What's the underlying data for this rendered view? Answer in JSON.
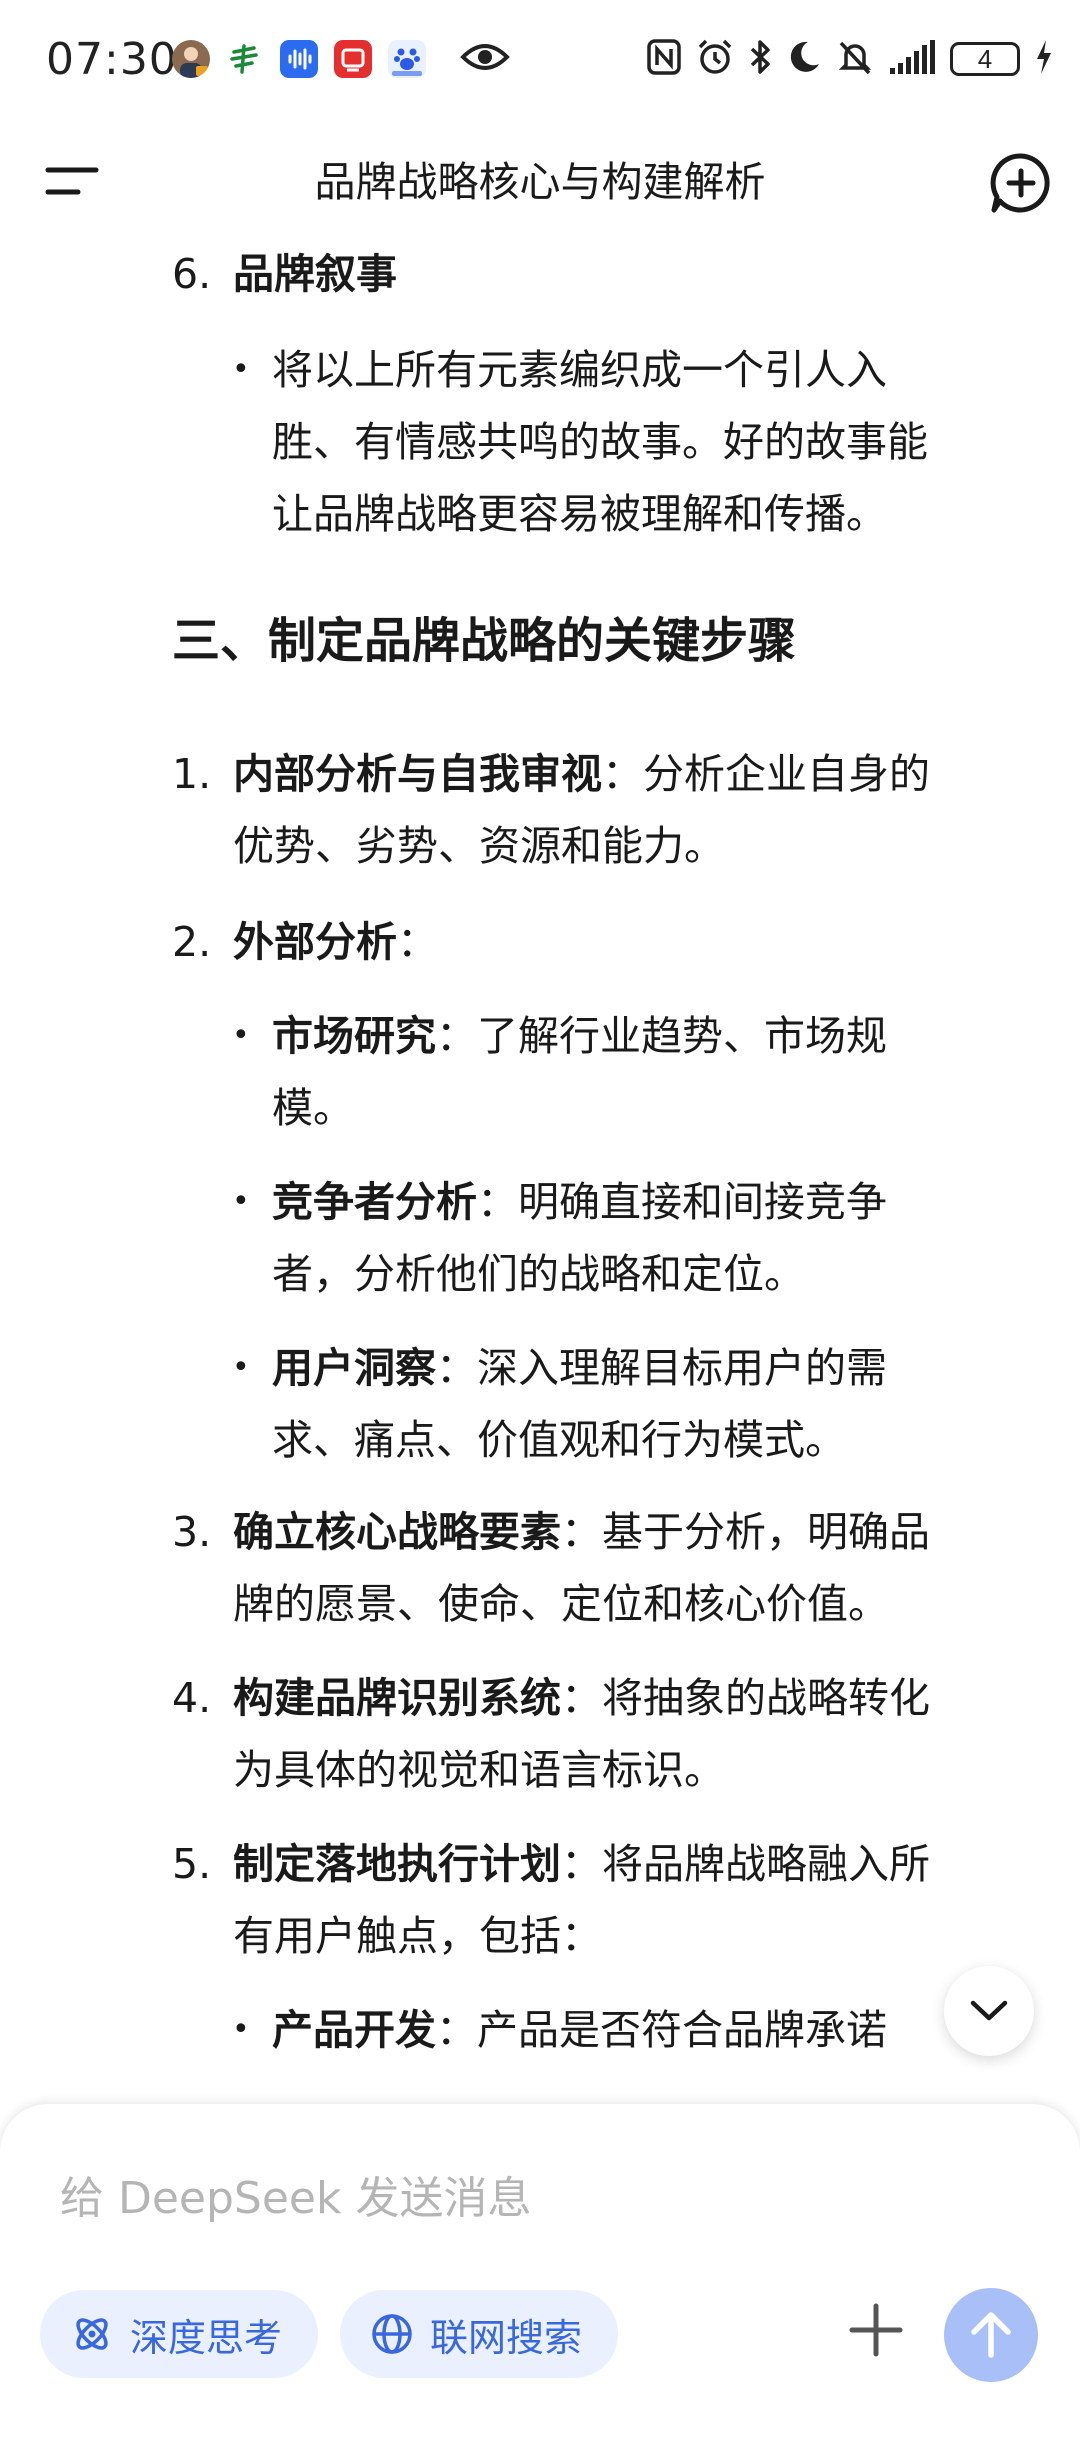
{
  "status_bar": {
    "time": "07:30",
    "battery_level": "4",
    "left_icons": [
      "avatar-app-icon",
      "bank-app-icon",
      "voice-app-icon",
      "red-app-icon",
      "baidu-app-icon",
      "eye-icon"
    ],
    "right_icons": [
      "nfc-icon",
      "alarm-icon",
      "bluetooth-icon",
      "do-not-disturb-icon",
      "mute-icon",
      "signal-icon",
      "battery-icon",
      "charging-icon"
    ]
  },
  "header": {
    "title": "品牌战略核心与构建解析",
    "menu_icon": "menu-icon",
    "new_chat_icon": "new-chat-icon"
  },
  "content": {
    "item6": {
      "number": "6.",
      "title": "品牌叙事",
      "bullet_lines": [
        "将以上所有元素编织成一个引人入",
        "胜、有情感共鸣的故事。好的故事能",
        "让品牌战略更容易被理解和传播。"
      ]
    },
    "section3_heading": "三、制定品牌战略的关键步骤",
    "steps": [
      {
        "number": "1.",
        "bold": "内部分析与自我审视",
        "line1_rest": "：分析企业自身的",
        "line2": "优势、劣势、资源和能力。"
      },
      {
        "number": "2.",
        "bold": "外部分析",
        "line1_rest": "：",
        "bullets": [
          {
            "bold": "市场研究",
            "line1_rest": "：了解行业趋势、市场规",
            "line2": "模。"
          },
          {
            "bold": "竞争者分析",
            "line1_rest": "：明确直接和间接竞争",
            "line2": "者，分析他们的战略和定位。"
          },
          {
            "bold": "用户洞察",
            "line1_rest": "：深入理解目标用户的需",
            "line2": "求、痛点、价值观和行为模式。"
          }
        ]
      },
      {
        "number": "3.",
        "bold": "确立核心战略要素",
        "line1_rest": "：基于分析，明确品",
        "line2": "牌的愿景、使命、定位和核心价值。"
      },
      {
        "number": "4.",
        "bold": "构建品牌识别系统",
        "line1_rest": "：将抽象的战略转化",
        "line2": "为具体的视觉和语言标识。"
      },
      {
        "number": "5.",
        "bold": "制定落地执行计划",
        "line1_rest": "：将品牌战略融入所",
        "line2": "有用户触点，包括：",
        "bullets": [
          {
            "bold": "产品开发",
            "line1_rest": "：产品是否符合品牌承诺"
          }
        ]
      }
    ]
  },
  "composer": {
    "placeholder": "给 DeepSeek 发送消息",
    "deep_think_label": "深度思考",
    "web_search_label": "联网搜索"
  },
  "colors": {
    "accent": "#3867de",
    "pill_bg": "#eaf0fd",
    "send_disabled": "#a9bff7"
  }
}
